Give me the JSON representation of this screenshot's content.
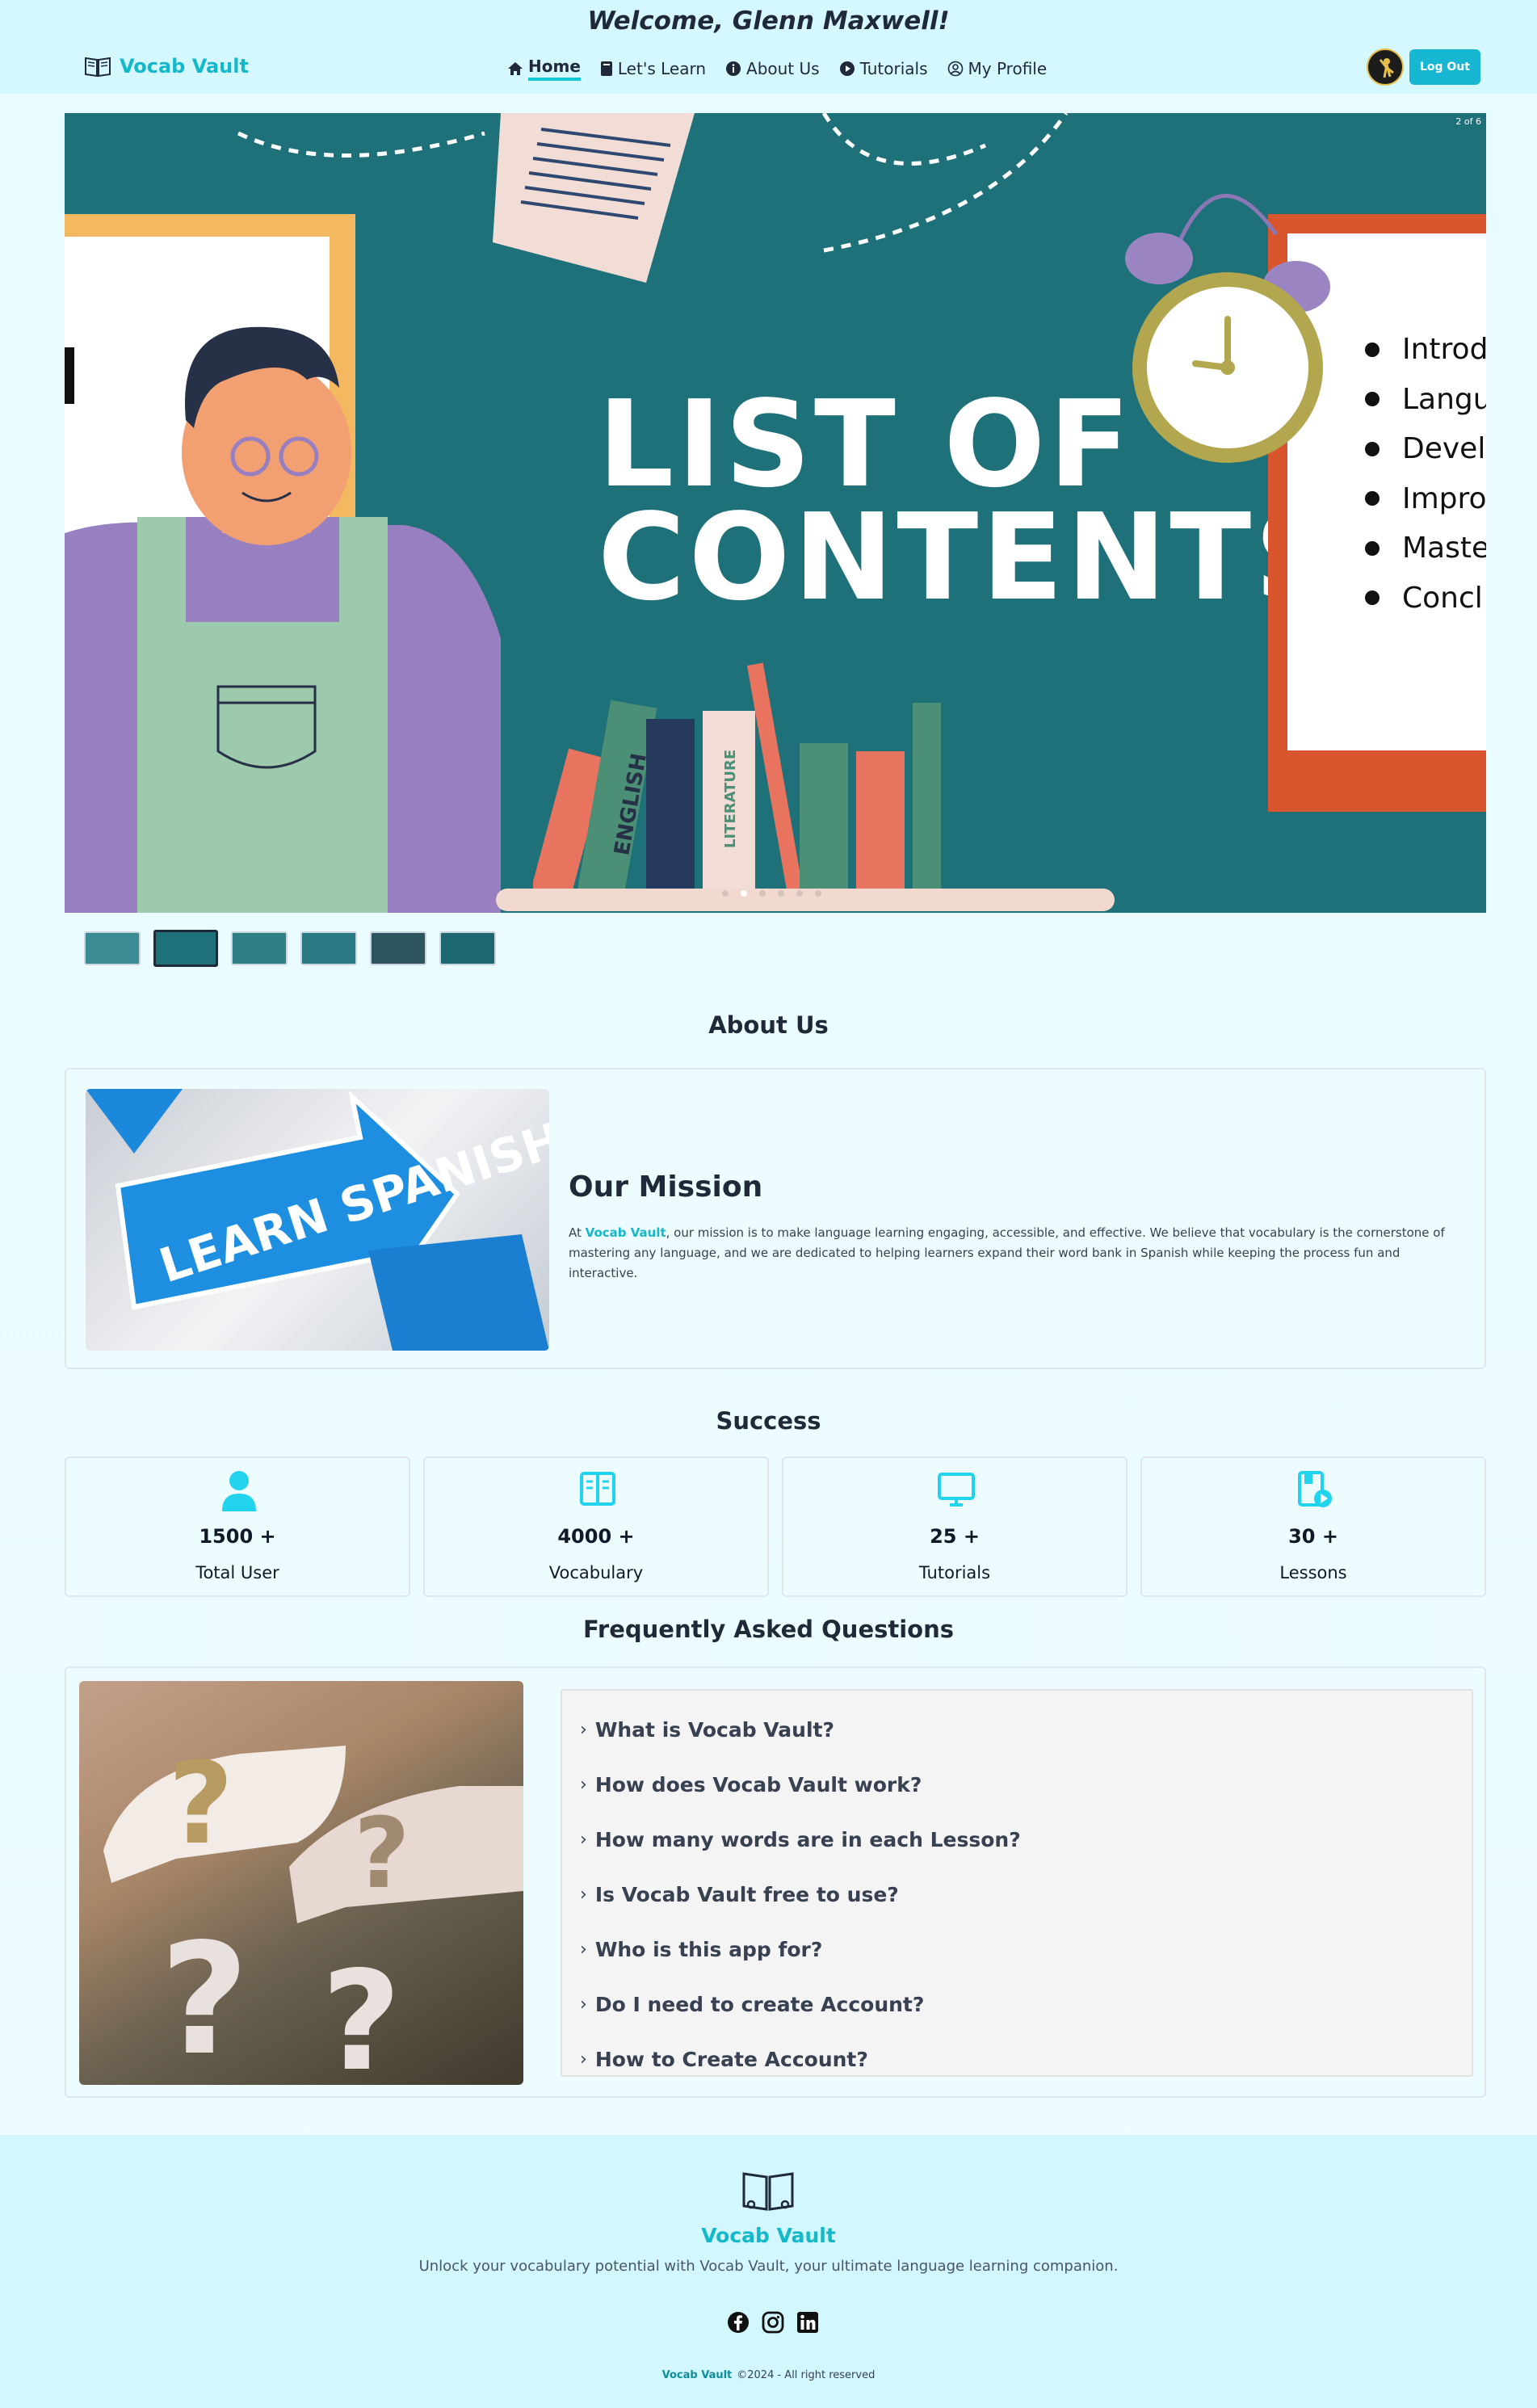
{
  "header": {
    "welcome": "Welcome, Glenn Maxwell!",
    "brand": "Vocab Vault",
    "nav": [
      {
        "label": "Home",
        "icon": "home-icon",
        "active": true
      },
      {
        "label": "Let's Learn",
        "icon": "book-icon"
      },
      {
        "label": "About Us",
        "icon": "info-icon"
      },
      {
        "label": "Tutorials",
        "icon": "play-icon"
      },
      {
        "label": "My Profile",
        "icon": "user-circle-icon"
      }
    ],
    "logout_label": "Log Out"
  },
  "carousel": {
    "counter": "2 of 6",
    "slide_title_line1": "LIST OF",
    "slide_title_line2": "CONTENTS",
    "book_label_1": "ENGLISH",
    "book_label_2": "LITERATURE",
    "bullets": [
      "Introd",
      "Langu",
      "Devel",
      "Impro",
      "Maste",
      "Concl"
    ],
    "total_slides": 6,
    "active_index": 1
  },
  "about": {
    "title": "About Us",
    "image_text": "LEARN SPANISH",
    "mission_title": "Our Mission",
    "mission_prefix": "At ",
    "mission_brand": "Vocab Vault",
    "mission_body": ", our mission is to make language learning engaging, accessible, and effective. We believe that vocabulary is the cornerstone of mastering any language, and we are dedicated to helping learners expand their word bank in Spanish while keeping the process fun and interactive."
  },
  "success": {
    "title": "Success",
    "stats": [
      {
        "value": "1500 +",
        "label": "Total User",
        "icon": "user-icon"
      },
      {
        "value": "4000 +",
        "label": "Vocabulary",
        "icon": "open-book-icon"
      },
      {
        "value": "25 +",
        "label": "Tutorials",
        "icon": "monitor-icon"
      },
      {
        "value": "30 +",
        "label": "Lessons",
        "icon": "lesson-video-icon"
      }
    ]
  },
  "faq": {
    "title": "Frequently Asked Questions",
    "questions": [
      "What is Vocab Vault?",
      "How does Vocab Vault work?",
      "How many words are in each Lesson?",
      "Is Vocab Vault free to use?",
      "Who is this app for?",
      "Do I need to create Account?",
      "How to Create Account?"
    ]
  },
  "footer": {
    "brand": "Vocab Vault",
    "tagline": "Unlock your vocabulary potential with Vocab Vault, your ultimate language learning companion.",
    "socials": [
      "facebook-icon",
      "instagram-icon",
      "linkedin-icon"
    ],
    "copyright_brand": "Vocab Vault",
    "copyright": "©2024 - All right reserved"
  },
  "colors": {
    "accent": "#14b8c9",
    "header_bg": "#d4f8fd",
    "slide_bg": "#1e7079",
    "logout_bg": "#17b6d3"
  }
}
